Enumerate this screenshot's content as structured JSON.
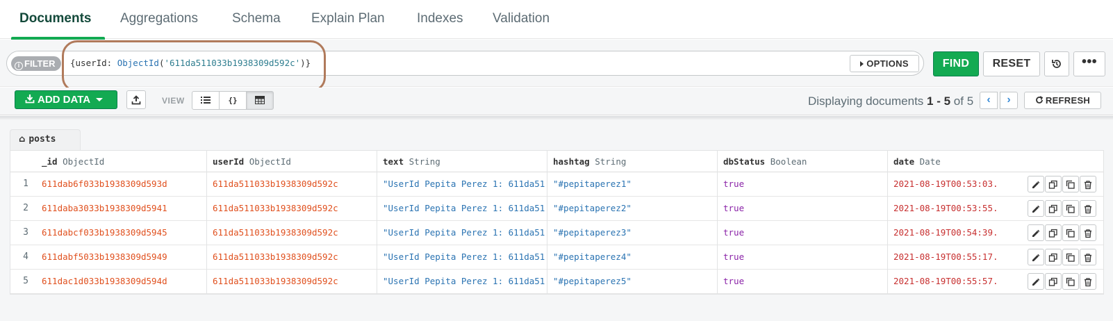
{
  "tabs": [
    {
      "label": "Documents",
      "active": true
    },
    {
      "label": "Aggregations",
      "active": false
    },
    {
      "label": "Schema",
      "active": false
    },
    {
      "label": "Explain Plan",
      "active": false
    },
    {
      "label": "Indexes",
      "active": false
    },
    {
      "label": "Validation",
      "active": false
    }
  ],
  "filter": {
    "pill_label": "FILTER",
    "query_prefix": "{userId: ",
    "query_fn": "ObjectId",
    "query_open": "(",
    "query_arg": "'611da511033b1938309d592c'",
    "query_close": ")}",
    "options_label": "OPTIONS"
  },
  "buttons": {
    "find": "FIND",
    "reset": "RESET",
    "more": "•••"
  },
  "toolbar": {
    "add_data": "ADD DATA",
    "view_label": "VIEW",
    "json_view_glyph": "{}",
    "displaying_prefix": "Displaying documents ",
    "range_start": "1",
    "range_sep": " - ",
    "range_end": "5",
    "of_text": " of ",
    "total": "5",
    "refresh": "REFRESH"
  },
  "collection": "posts",
  "columns": [
    {
      "name": "_id",
      "type": "ObjectId"
    },
    {
      "name": "userId",
      "type": "ObjectId"
    },
    {
      "name": "text",
      "type": "String"
    },
    {
      "name": "hashtag",
      "type": "String"
    },
    {
      "name": "dbStatus",
      "type": "Boolean"
    },
    {
      "name": "date",
      "type": "Date"
    }
  ],
  "rows": [
    {
      "num": "1",
      "id": "611dab6f033b1938309d593d",
      "userId": "611da511033b1938309d592c",
      "text": "\"UserId Pepita Perez 1: 611da51",
      "hashtag": "\"#pepitaperez1\"",
      "dbStatus": "true",
      "date": "2021-08-19T00:53:03."
    },
    {
      "num": "2",
      "id": "611daba3033b1938309d5941",
      "userId": "611da511033b1938309d592c",
      "text": "\"UserId Pepita Perez 1: 611da51",
      "hashtag": "\"#pepitaperez2\"",
      "dbStatus": "true",
      "date": "2021-08-19T00:53:55."
    },
    {
      "num": "3",
      "id": "611dabcf033b1938309d5945",
      "userId": "611da511033b1938309d592c",
      "text": "\"UserId Pepita Perez 1: 611da51",
      "hashtag": "\"#pepitaperez3\"",
      "dbStatus": "true",
      "date": "2021-08-19T00:54:39."
    },
    {
      "num": "4",
      "id": "611dabf5033b1938309d5949",
      "userId": "611da511033b1938309d592c",
      "text": "\"UserId Pepita Perez 1: 611da51",
      "hashtag": "\"#pepitaperez4\"",
      "dbStatus": "true",
      "date": "2021-08-19T00:55:17."
    },
    {
      "num": "5",
      "id": "611dac1d033b1938309d594d",
      "userId": "611da511033b1938309d592c",
      "text": "\"UserId Pepita Perez 1: 611da51",
      "hashtag": "\"#pepitaperez5\"",
      "dbStatus": "true",
      "date": "2021-08-19T00:55:57."
    }
  ],
  "colors": {
    "accent_green": "#13aa52",
    "objectid": "#e0501e",
    "string": "#2a73b2",
    "boolean": "#8b24a8",
    "date": "#c72f2f",
    "highlight_annotation": "#b07a5b"
  }
}
